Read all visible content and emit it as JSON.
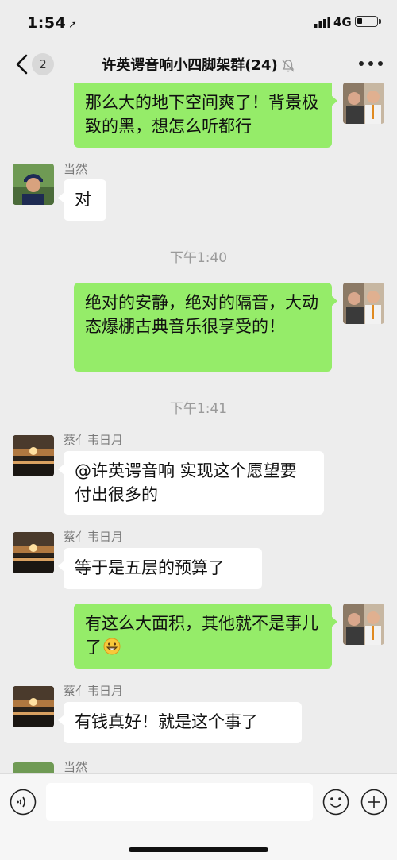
{
  "status_bar": {
    "time": "1:54",
    "network": "4G",
    "battery_level": 0.25
  },
  "header": {
    "unread_count": "2",
    "title": "许英谔音响小四脚架群(24)"
  },
  "messages": [
    {
      "side": "me",
      "text": "那么大的地下空间爽了！背景极致的黑，想怎么听都行"
    },
    {
      "side": "other",
      "sender": "当然",
      "text": "对"
    },
    {
      "type": "timestamp",
      "text": "下午1:40"
    },
    {
      "side": "me",
      "text": "绝对的安静，绝对的隔音，大动态爆棚古典音乐很享受的！"
    },
    {
      "type": "timestamp",
      "text": "下午1:41"
    },
    {
      "side": "other",
      "sender": "蔡亻韦日月",
      "text": "@许英谔音响 实现这个愿望要付出很多的"
    },
    {
      "side": "other",
      "sender": "蔡亻韦日月",
      "text": "等于是五层的预算了"
    },
    {
      "side": "me",
      "text": "有这么大面积，其他就不是事儿了",
      "emoji": "grin"
    },
    {
      "side": "other",
      "sender": "蔡亻韦日月",
      "text": "有钱真好！就是这个事了"
    },
    {
      "side": "other",
      "sender": "当然",
      "text": ""
    }
  ],
  "input": {
    "placeholder": ""
  },
  "colors": {
    "me_bubble": "#95ec69",
    "other_bubble": "#ffffff",
    "background": "#ededed"
  },
  "icons": {
    "back": "chevron-left-icon",
    "mute": "bell-slash-icon",
    "more": "ellipsis-icon",
    "voice": "voice-icon",
    "emoji": "smiley-icon",
    "plus": "plus-icon"
  }
}
